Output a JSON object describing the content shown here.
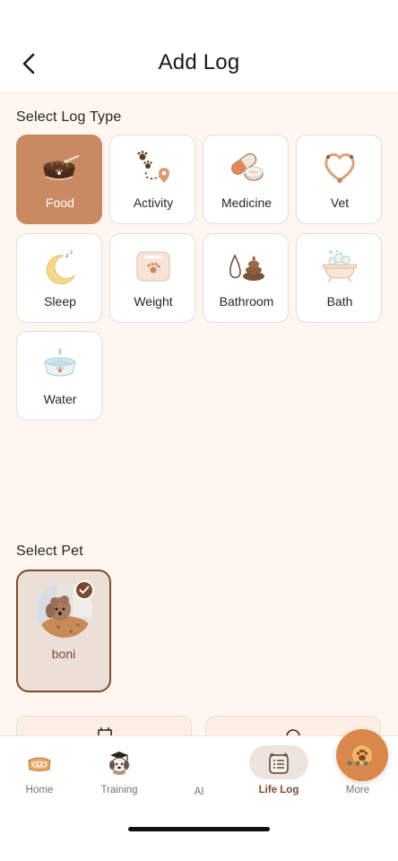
{
  "header": {
    "title": "Add Log",
    "back_icon": "chevron-left-icon"
  },
  "log_type": {
    "section_title": "Select Log Type",
    "selected": "Food",
    "items": [
      {
        "label": "Food",
        "icon": "food-bowl-icon"
      },
      {
        "label": "Activity",
        "icon": "paw-trail-icon"
      },
      {
        "label": "Medicine",
        "icon": "pill-icon"
      },
      {
        "label": "Vet",
        "icon": "stethoscope-icon"
      },
      {
        "label": "Sleep",
        "icon": "moon-icon"
      },
      {
        "label": "Weight",
        "icon": "scale-icon"
      },
      {
        "label": "Bathroom",
        "icon": "poop-icon"
      },
      {
        "label": "Bath",
        "icon": "bathtub-icon"
      },
      {
        "label": "Water",
        "icon": "water-bowl-icon"
      }
    ]
  },
  "pet": {
    "section_title": "Select Pet",
    "pets": [
      {
        "name": "boni",
        "selected": true
      }
    ]
  },
  "tabbar": {
    "tabs": [
      {
        "label": "Home",
        "icon": "home-bed-icon"
      },
      {
        "label": "Training",
        "icon": "graduate-dog-icon"
      },
      {
        "label": "AI",
        "icon": "ai-paw-icon"
      },
      {
        "label": "Life Log",
        "icon": "life-log-icon",
        "active": true
      },
      {
        "label": "More",
        "icon": "more-dots-icon"
      }
    ]
  },
  "colors": {
    "accent": "#c98a63",
    "brand_brown": "#7b4a30",
    "ai_orange": "#d8884a",
    "page_bg": "#fdf6f1"
  }
}
